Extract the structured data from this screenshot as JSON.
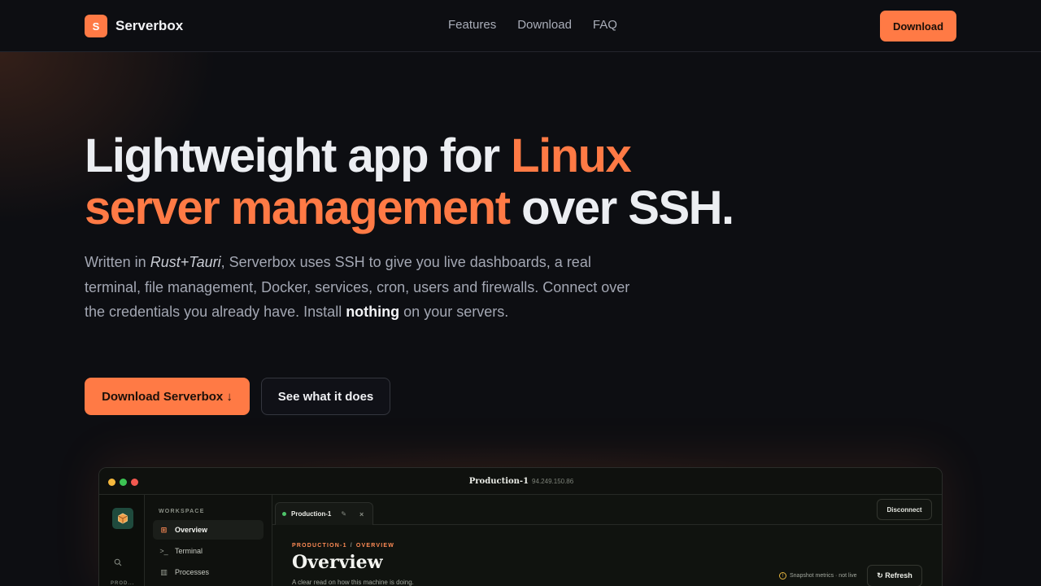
{
  "nav": {
    "brand_letter": "S",
    "brand_name": "Serverbox",
    "links": [
      "Features",
      "Download",
      "FAQ"
    ],
    "cta": "Download"
  },
  "hero": {
    "title_part1": "Lightweight app for ",
    "title_accent1": "Linux",
    "title_accent2": "server management",
    "title_part2": " over SSH.",
    "sub_1": "Written in ",
    "sub_em": "Rust+Tauri",
    "sub_2": ", Serverbox uses SSH to give you live dashboards, a real terminal, file management, Docker, services, cron, users and firewalls. Connect over the credentials you already have. Install ",
    "sub_strong": "nothing",
    "sub_3": " on your servers.",
    "primary_button": "Download Serverbox ↓",
    "secondary_button": "See what it does"
  },
  "app": {
    "window_title": "Production-1",
    "window_ip": "94.249.150.86",
    "rail_label": "PROD...",
    "sidebar_heading": "WORKSPACE",
    "sidebar_items": [
      {
        "label": "Overview",
        "icon": "grid-icon",
        "glyph": "⊞"
      },
      {
        "label": "Terminal",
        "icon": "terminal-icon",
        "glyph": ">_"
      },
      {
        "label": "Processes",
        "icon": "bar-chart-icon",
        "glyph": "▥"
      }
    ],
    "tab_label": "Production-1",
    "disconnect": "Disconnect",
    "breadcrumb_1": "PRODUCTION-1",
    "breadcrumb_sep": "/",
    "breadcrumb_2": "OVERVIEW",
    "page_title": "Overview",
    "page_subtitle": "A clear read on how this machine is doing.",
    "snapshot_note": "Snapshot metrics · not live",
    "refresh": "Refresh"
  },
  "colors": {
    "accent": "#ff7a45",
    "background": "#0d0e12",
    "app_background": "#10130f",
    "status_green": "#4ec46a"
  }
}
